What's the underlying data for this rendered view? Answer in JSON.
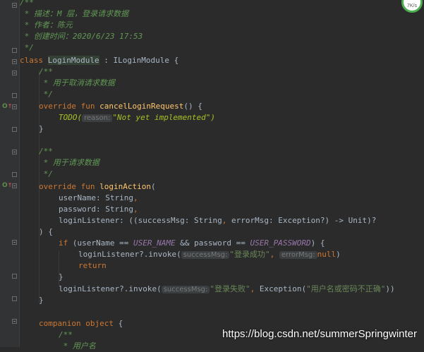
{
  "editor": {
    "lines": {
      "l1": "/**",
      "l2": " * 描述：M 层，登录请求数据",
      "l3": " * 作者：陈元",
      "l4": " * 创建时间：2020/6/23 17:53",
      "l5": " */",
      "class_kw": "class",
      "class_name": "LoginModule",
      "class_rest": " : ILoginModule {",
      "c1_open": "/**",
      "c1_text": " * 用于取消请求数据",
      "c1_close": " */",
      "override1": "override",
      "fun1": "fun",
      "fn1_name": "cancelLoginRequest",
      "fn1_rest": "() {",
      "todo": "TODO(",
      "todo_hint": "reason:",
      "todo_str": "\"Not yet implemented\"",
      "todo_close": ")",
      "brace1": "}",
      "c2_open": "/**",
      "c2_text": " * 用于请求数据",
      "c2_close": " */",
      "override2": "override",
      "fun2": "fun",
      "fn2_name": "loginAction",
      "fn2_rest": "(",
      "p1_name": "userName: String",
      "p1_comma": ",",
      "p2_name": "password: String",
      "p2_comma": ",",
      "p3": "loginListener: ((successMsg: String",
      "p3_comma": ",",
      "p3_b": " errorMsg: Exception?) -> Unit)?",
      "close_paren": ") {",
      "if_kw": "if",
      "if_a": " (userName == ",
      "if_const1": "USER_NAME",
      "if_b": " && password == ",
      "if_const2": "USER_PASSWORD",
      "if_c": ") {",
      "invoke1_a": "loginListener?.invoke(",
      "invoke1_hint1": "successMsg:",
      "invoke1_str": "\"登录成功\"",
      "invoke1_comma": ",",
      "invoke1_hint2": "errorMsg:",
      "invoke1_null": "null",
      "invoke1_close": ")",
      "return_kw": "return",
      "brace2": "}",
      "invoke2_a": "loginListener?.invoke(",
      "invoke2_hint": "successMsg:",
      "invoke2_str": "\"登录失败\"",
      "invoke2_comma": ",",
      "invoke2_b": " Exception(",
      "invoke2_str2": "\"用户名或密码不正确\"",
      "invoke2_close": "))",
      "brace3": "}",
      "companion_kw": "companion object",
      "companion_brace": " {",
      "c3_open": "/**",
      "c3_text": " * 用户名"
    },
    "widget_text": "7K/s"
  },
  "watermark": "https://blog.csdn.net/summerSpringwinter",
  "colors": {
    "background": "#2b2b2b",
    "keyword": "#cc7832",
    "comment": "#629755",
    "string": "#6a8759",
    "function": "#ffc66d",
    "constant": "#9876aa"
  }
}
